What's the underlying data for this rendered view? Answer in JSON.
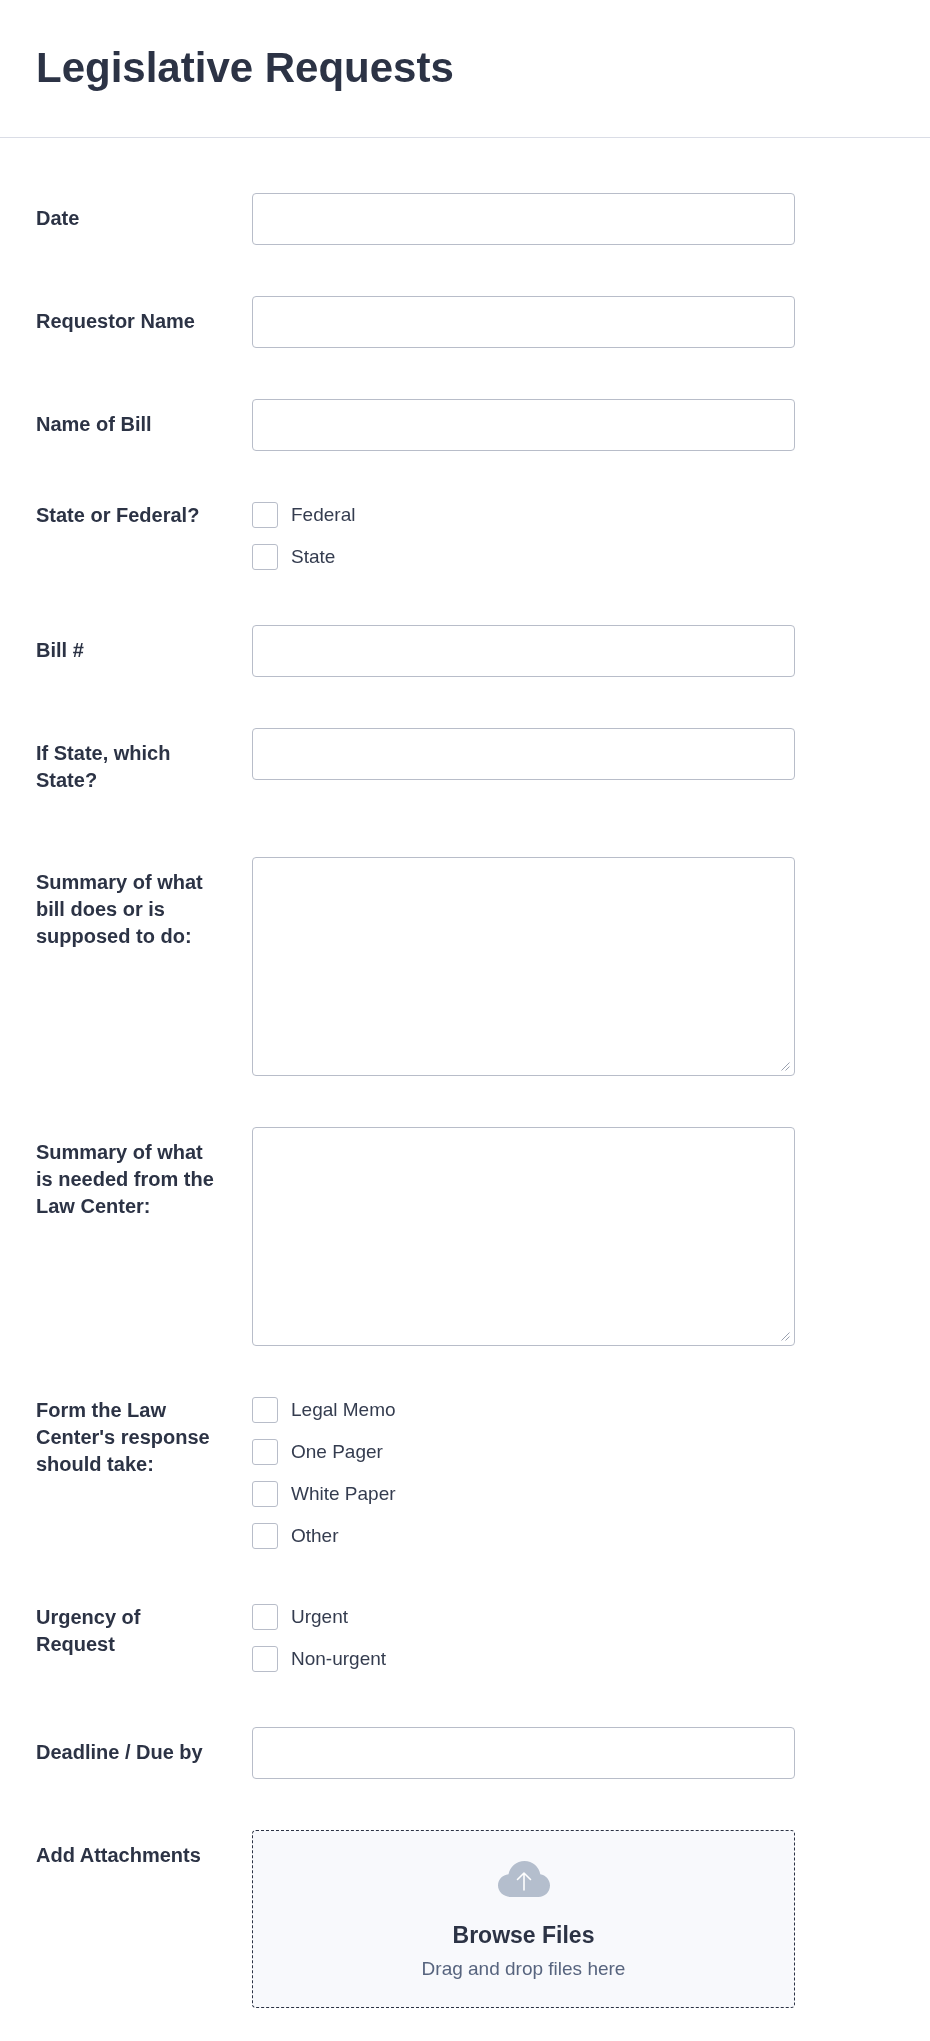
{
  "title": "Legislative Requests",
  "fields": [
    {
      "kind": "text",
      "label": "Date"
    },
    {
      "kind": "text",
      "label": "Requestor Name"
    },
    {
      "kind": "text",
      "label": "Name of Bill"
    },
    {
      "kind": "checkboxes",
      "label": "State or Federal?",
      "options": [
        {
          "label": "Federal",
          "checked": false
        },
        {
          "label": "State",
          "checked": false
        }
      ]
    },
    {
      "kind": "text",
      "label": "Bill #"
    },
    {
      "kind": "text",
      "label": "If State, which State?"
    },
    {
      "kind": "textarea",
      "label": "Summary of what bill does or is supposed to do:"
    },
    {
      "kind": "textarea",
      "label": "Summary of what is needed from the Law Center:"
    },
    {
      "kind": "checkboxes",
      "label": "Form the Law Center's response should take:",
      "options": [
        {
          "label": "Legal Memo",
          "checked": false
        },
        {
          "label": "One Pager",
          "checked": false
        },
        {
          "label": "White Paper",
          "checked": false
        },
        {
          "label": "Other",
          "checked": false
        }
      ]
    },
    {
      "kind": "checkboxes",
      "label": "Urgency of Request",
      "options": [
        {
          "label": "Urgent",
          "checked": false
        },
        {
          "label": "Non-urgent",
          "checked": false
        }
      ]
    },
    {
      "kind": "text",
      "label": "Deadline / Due by"
    },
    {
      "kind": "upload",
      "label": "Add Attachments",
      "button": "Browse Files",
      "hint": "Drag and drop files here"
    }
  ]
}
